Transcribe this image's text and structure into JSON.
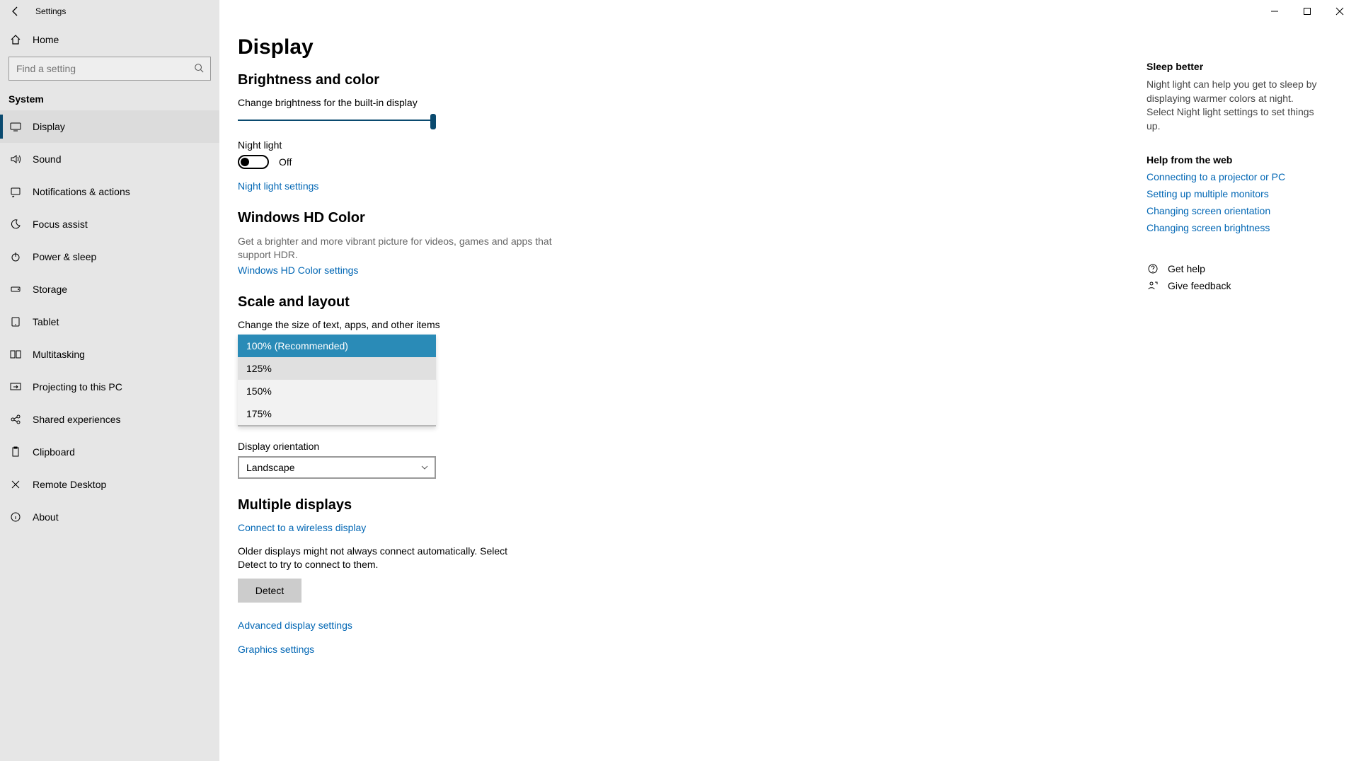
{
  "titlebar": {
    "app_name": "Settings"
  },
  "sidebar": {
    "home": "Home",
    "search_placeholder": "Find a setting",
    "section": "System",
    "items": [
      {
        "label": "Display"
      },
      {
        "label": "Sound"
      },
      {
        "label": "Notifications & actions"
      },
      {
        "label": "Focus assist"
      },
      {
        "label": "Power & sleep"
      },
      {
        "label": "Storage"
      },
      {
        "label": "Tablet"
      },
      {
        "label": "Multitasking"
      },
      {
        "label": "Projecting to this PC"
      },
      {
        "label": "Shared experiences"
      },
      {
        "label": "Clipboard"
      },
      {
        "label": "Remote Desktop"
      },
      {
        "label": "About"
      }
    ]
  },
  "page": {
    "title": "Display",
    "brightness": {
      "heading": "Brightness and color",
      "slider_label": "Change brightness for the built-in display",
      "night_light_label": "Night light",
      "night_light_state": "Off",
      "night_light_link": "Night light settings"
    },
    "hdcolor": {
      "heading": "Windows HD Color",
      "desc": "Get a brighter and more vibrant picture for videos, games and apps that support HDR.",
      "link": "Windows HD Color settings"
    },
    "scale": {
      "heading": "Scale and layout",
      "size_label": "Change the size of text, apps, and other items",
      "options": [
        "100% (Recommended)",
        "125%",
        "150%",
        "175%"
      ],
      "orientation_label": "Display orientation",
      "orientation_value": "Landscape"
    },
    "multi": {
      "heading": "Multiple displays",
      "connect_link": "Connect to a wireless display",
      "desc": "Older displays might not always connect automatically. Select Detect to try to connect to them.",
      "detect": "Detect",
      "adv_link": "Advanced display settings",
      "gfx_link": "Graphics settings"
    }
  },
  "help": {
    "sleep_hdr": "Sleep better",
    "sleep_txt": "Night light can help you get to sleep by displaying warmer colors at night. Select Night light settings to set things up.",
    "web_hdr": "Help from the web",
    "links": [
      "Connecting to a projector or PC",
      "Setting up multiple monitors",
      "Changing screen orientation",
      "Changing screen brightness"
    ],
    "get_help": "Get help",
    "feedback": "Give feedback"
  }
}
